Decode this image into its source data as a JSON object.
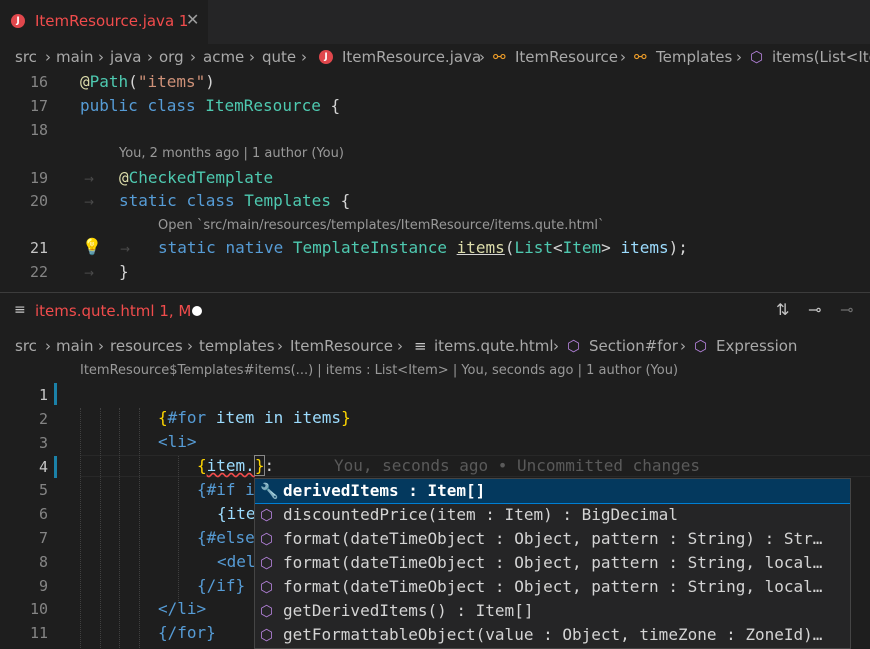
{
  "top_tab": {
    "title": "ItemResource.java",
    "problems": "1",
    "file_badge": "J",
    "close": "✕"
  },
  "top_breadcrumbs": [
    "src",
    "main",
    "java",
    "org",
    "acme",
    "qute",
    "ItemResource.java",
    "ItemResource",
    "Templates",
    "items(List<Ite"
  ],
  "top_code": {
    "lines": [
      "16",
      "17",
      "18",
      "19",
      "20",
      "21",
      "22"
    ],
    "l16": {
      "at": "@",
      "ann": "Path",
      "open": "(",
      "str": "\"items\"",
      "close": ")"
    },
    "l17": {
      "kw1": "public",
      "kw2": "class",
      "name": "ItemResource",
      "brace": "{"
    },
    "lens1": "You, 2 months ago | 1 author (You)",
    "l19": {
      "at": "@",
      "ann": "CheckedTemplate"
    },
    "l20": {
      "kw1": "static",
      "kw2": "class",
      "name": "Templates",
      "brace": "{"
    },
    "lens2": "Open `src/main/resources/templates/ItemResource/items.qute.html`",
    "l21": {
      "kw1": "static",
      "kw2": "native",
      "type": "TemplateInstance",
      "fn": "items",
      "p1": "(",
      "t1": "List",
      "lt": "<",
      "t2": "Item",
      "gt": ">",
      "param": "items",
      "end": ");"
    },
    "l22": {
      "brace": "}"
    }
  },
  "bottom_tab": {
    "title": "items.qute.html",
    "status": "1, M"
  },
  "bottom_breadcrumbs": [
    "src",
    "main",
    "resources",
    "templates",
    "ItemResource",
    "items.qute.html",
    "Section#for",
    "Expression"
  ],
  "bottom_lens": "ItemResource$Templates#items(...) | items : List<Item> | You, seconds ago | 1 author (You)",
  "bottom_code": {
    "lines": [
      "1",
      "2",
      "3",
      "4",
      "5",
      "6",
      "7",
      "8",
      "9",
      "10",
      "11"
    ],
    "l2": {
      "open": "{",
      "for": "#for",
      "v1": "item",
      "in": "in",
      "v2": "items",
      "close": "}"
    },
    "l3": "<li>",
    "l4": {
      "open": "{",
      "expr": "item.",
      "close": "}",
      "colon": ":"
    },
    "l4_blame": "You, seconds ago • Uncommitted changes",
    "l5": "{#if i",
    "l6": "{ite",
    "l7": "{#else",
    "l8": "<del",
    "l9": "{/if}",
    "l10": "</li>",
    "l11": "{/for}"
  },
  "suggestions": [
    {
      "label": "derivedItems : Item[]",
      "icon": "wrench-icon"
    },
    {
      "label": "discountedPrice(item : Item) : BigDecimal",
      "icon": "cube-icon"
    },
    {
      "label": "format(dateTimeObject : Object, pattern : String) : Str…",
      "icon": "cube-icon"
    },
    {
      "label": "format(dateTimeObject : Object, pattern : String, local…",
      "icon": "cube-icon"
    },
    {
      "label": "format(dateTimeObject : Object, pattern : String, local…",
      "icon": "cube-icon"
    },
    {
      "label": "getDerivedItems() : Item[]",
      "icon": "cube-icon"
    },
    {
      "label": "getFormattableObject(value : Object, timeZone : ZoneId)…",
      "icon": "cube-icon"
    }
  ]
}
